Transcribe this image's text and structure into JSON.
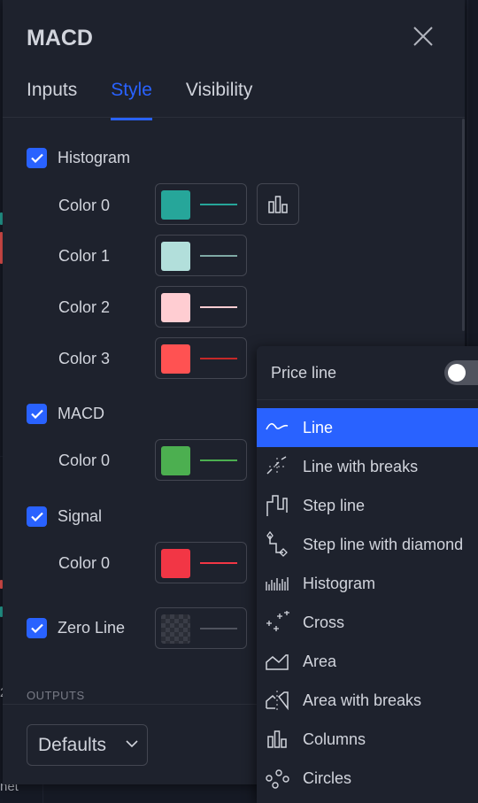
{
  "dialog": {
    "title": "MACD",
    "tabs": [
      {
        "label": "Inputs",
        "active": false
      },
      {
        "label": "Style",
        "active": true
      },
      {
        "label": "Visibility",
        "active": false
      }
    ]
  },
  "style": {
    "histogram": {
      "label": "Histogram",
      "checked": true,
      "colors": [
        {
          "label": "Color 0",
          "color": "#26a69a"
        },
        {
          "label": "Color 1",
          "color": "#b2dfdb"
        },
        {
          "label": "Color 2",
          "color": "#ffcdd2"
        },
        {
          "label": "Color 3",
          "color": "#ff5252"
        }
      ]
    },
    "macd": {
      "label": "MACD",
      "checked": true,
      "color_label": "Color 0",
      "color": "#4caf50"
    },
    "signal": {
      "label": "Signal",
      "checked": true,
      "color_label": "Color 0",
      "color": "#f23645"
    },
    "zero_line": {
      "label": "Zero Line",
      "checked": true
    }
  },
  "outputs_label": "OUTPUTS",
  "defaults_button": "Defaults",
  "background_text": {
    "left_cut_2": "2",
    "left_cut_net": "net"
  },
  "dropdown": {
    "price_line_label": "Price line",
    "price_line_on": false,
    "items": [
      {
        "label": "Line",
        "icon": "line-icon",
        "selected": true
      },
      {
        "label": "Line with breaks",
        "icon": "line-with-breaks-icon",
        "selected": false
      },
      {
        "label": "Step line",
        "icon": "step-line-icon",
        "selected": false
      },
      {
        "label": "Step line with diamond",
        "icon": "step-line-diamond-icon",
        "selected": false
      },
      {
        "label": "Histogram",
        "icon": "histogram-icon",
        "selected": false
      },
      {
        "label": "Cross",
        "icon": "cross-icon",
        "selected": false
      },
      {
        "label": "Area",
        "icon": "area-icon",
        "selected": false
      },
      {
        "label": "Area with breaks",
        "icon": "area-with-breaks-icon",
        "selected": false
      },
      {
        "label": "Columns",
        "icon": "columns-icon",
        "selected": false
      },
      {
        "label": "Circles",
        "icon": "circles-icon",
        "selected": false
      }
    ]
  },
  "colors": {
    "accent": "#2962ff",
    "panel": "#1e222d",
    "border": "#434651",
    "text": "#d1d4dc"
  }
}
